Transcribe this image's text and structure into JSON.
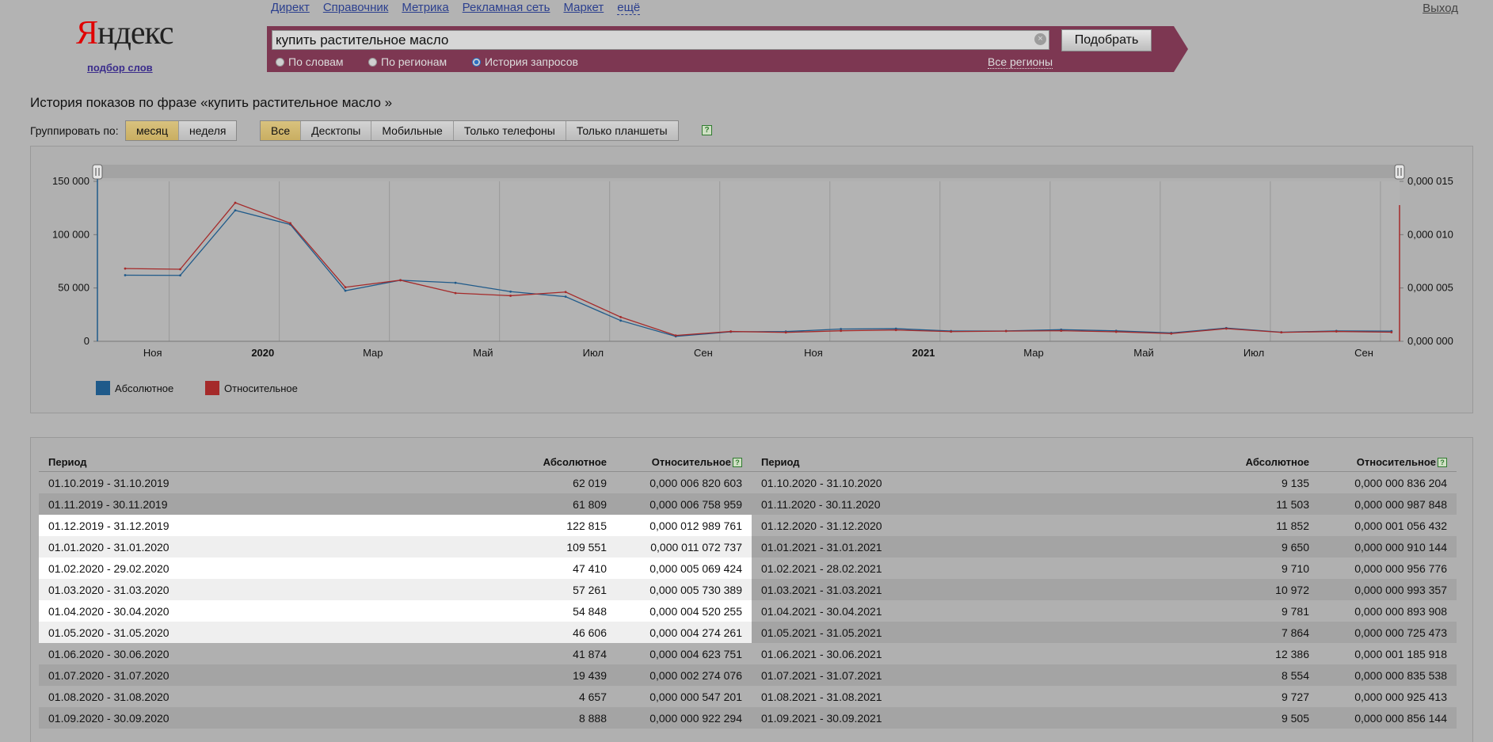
{
  "header": {
    "logo_first": "Я",
    "logo_rest": "ндекс",
    "logo_sub": "подбор слов",
    "nav": [
      "Директ",
      "Справочник",
      "Метрика",
      "Рекламная сеть",
      "Маркет",
      "ещё"
    ],
    "logout": "Выход"
  },
  "search": {
    "query": "купить растительное масло",
    "button": "Подобрать",
    "modes": [
      {
        "label": "По словам",
        "selected": false
      },
      {
        "label": "По регионам",
        "selected": false
      },
      {
        "label": "История запросов",
        "selected": true
      }
    ],
    "regions": "Все регионы",
    "clear_icon": "×"
  },
  "page": {
    "title": "История показов по фразе «купить растительное масло »",
    "group_label": "Группировать по:",
    "group_options": [
      {
        "label": "месяц",
        "selected": true
      },
      {
        "label": "неделя",
        "selected": false
      }
    ],
    "device_options": [
      {
        "label": "Все",
        "selected": true
      },
      {
        "label": "Десктопы",
        "selected": false
      },
      {
        "label": "Мобильные",
        "selected": false
      },
      {
        "label": "Только телефоны",
        "selected": false
      },
      {
        "label": "Только планшеты",
        "selected": false
      }
    ],
    "help_icon": "?"
  },
  "chart_data": {
    "type": "line",
    "x_ticks": [
      "Ноя",
      "2020",
      "Мар",
      "Май",
      "Июл",
      "Сен",
      "Ноя",
      "2021",
      "Мар",
      "Май",
      "Июл",
      "Сен"
    ],
    "bold_ticks": [
      "2020",
      "2021"
    ],
    "y_left_ticks": [
      "0",
      "50 000",
      "100 000",
      "150 000"
    ],
    "y_right_ticks": [
      "0,000 000",
      "0,000 005",
      "0,000 010",
      "0,000 015"
    ],
    "y_left_range": [
      0,
      150000
    ],
    "y_right_range": [
      0,
      1.5e-05
    ],
    "series": [
      {
        "name": "Абсолютное",
        "color": "#1f5a8a",
        "axis": "left",
        "values": [
          62019,
          61809,
          122815,
          109551,
          47410,
          57261,
          54848,
          46606,
          41874,
          19439,
          4657,
          8888,
          9135,
          11503,
          11852,
          9650,
          9710,
          10972,
          9781,
          7864,
          12386,
          8554,
          9727,
          9505
        ]
      },
      {
        "name": "Относительное",
        "color": "#a52a2a",
        "axis": "right",
        "values": [
          6.820603e-06,
          6.758959e-06,
          1.2989761e-05,
          1.1072737e-05,
          5.069424e-06,
          5.730389e-06,
          4.520255e-06,
          4.274261e-06,
          4.623751e-06,
          2.274076e-06,
          5.47201e-07,
          9.22294e-07,
          8.36204e-07,
          9.87848e-07,
          1.056432e-06,
          9.10144e-07,
          9.56776e-07,
          9.93357e-07,
          8.93908e-07,
          7.25473e-07,
          1.185918e-06,
          8.35538e-07,
          9.25413e-07,
          8.56144e-07
        ]
      }
    ],
    "legend": [
      "Абсолютное",
      "Относительное"
    ],
    "grid": true
  },
  "table": {
    "headers": [
      "Период",
      "Абсолютное",
      "Относительное"
    ],
    "left": [
      [
        "01.10.2019 - 31.10.2019",
        "62 019",
        "0,000 006 820 603"
      ],
      [
        "01.11.2019 - 30.11.2019",
        "61 809",
        "0,000 006 758 959"
      ],
      [
        "01.12.2019 - 31.12.2019",
        "122 815",
        "0,000 012 989 761"
      ],
      [
        "01.01.2020 - 31.01.2020",
        "109 551",
        "0,000 011 072 737"
      ],
      [
        "01.02.2020 - 29.02.2020",
        "47 410",
        "0,000 005 069 424"
      ],
      [
        "01.03.2020 - 31.03.2020",
        "57 261",
        "0,000 005 730 389"
      ],
      [
        "01.04.2020 - 30.04.2020",
        "54 848",
        "0,000 004 520 255"
      ],
      [
        "01.05.2020 - 31.05.2020",
        "46 606",
        "0,000 004 274 261"
      ],
      [
        "01.06.2020 - 30.06.2020",
        "41 874",
        "0,000 004 623 751"
      ],
      [
        "01.07.2020 - 31.07.2020",
        "19 439",
        "0,000 002 274 076"
      ],
      [
        "01.08.2020 - 31.08.2020",
        "4 657",
        "0,000 000 547 201"
      ],
      [
        "01.09.2020 - 30.09.2020",
        "8 888",
        "0,000 000 922 294"
      ]
    ],
    "right": [
      [
        "01.10.2020 - 31.10.2020",
        "9 135",
        "0,000 000 836 204"
      ],
      [
        "01.11.2020 - 30.11.2020",
        "11 503",
        "0,000 000 987 848"
      ],
      [
        "01.12.2020 - 31.12.2020",
        "11 852",
        "0,000 001 056 432"
      ],
      [
        "01.01.2021 - 31.01.2021",
        "9 650",
        "0,000 000 910 144"
      ],
      [
        "01.02.2021 - 28.02.2021",
        "9 710",
        "0,000 000 956 776"
      ],
      [
        "01.03.2021 - 31.03.2021",
        "10 972",
        "0,000 000 993 357"
      ],
      [
        "01.04.2021 - 30.04.2021",
        "9 781",
        "0,000 000 893 908"
      ],
      [
        "01.05.2021 - 31.05.2021",
        "7 864",
        "0,000 000 725 473"
      ],
      [
        "01.06.2021 - 30.06.2021",
        "12 386",
        "0,000 001 185 918"
      ],
      [
        "01.07.2021 - 31.07.2021",
        "8 554",
        "0,000 000 835 538"
      ],
      [
        "01.08.2021 - 31.08.2021",
        "9 727",
        "0,000 000 925 413"
      ],
      [
        "01.09.2021 - 30.09.2021",
        "9 505",
        "0,000 000 856 144"
      ]
    ],
    "highlight_rows_left": [
      2,
      3,
      4,
      5,
      6,
      7
    ]
  }
}
